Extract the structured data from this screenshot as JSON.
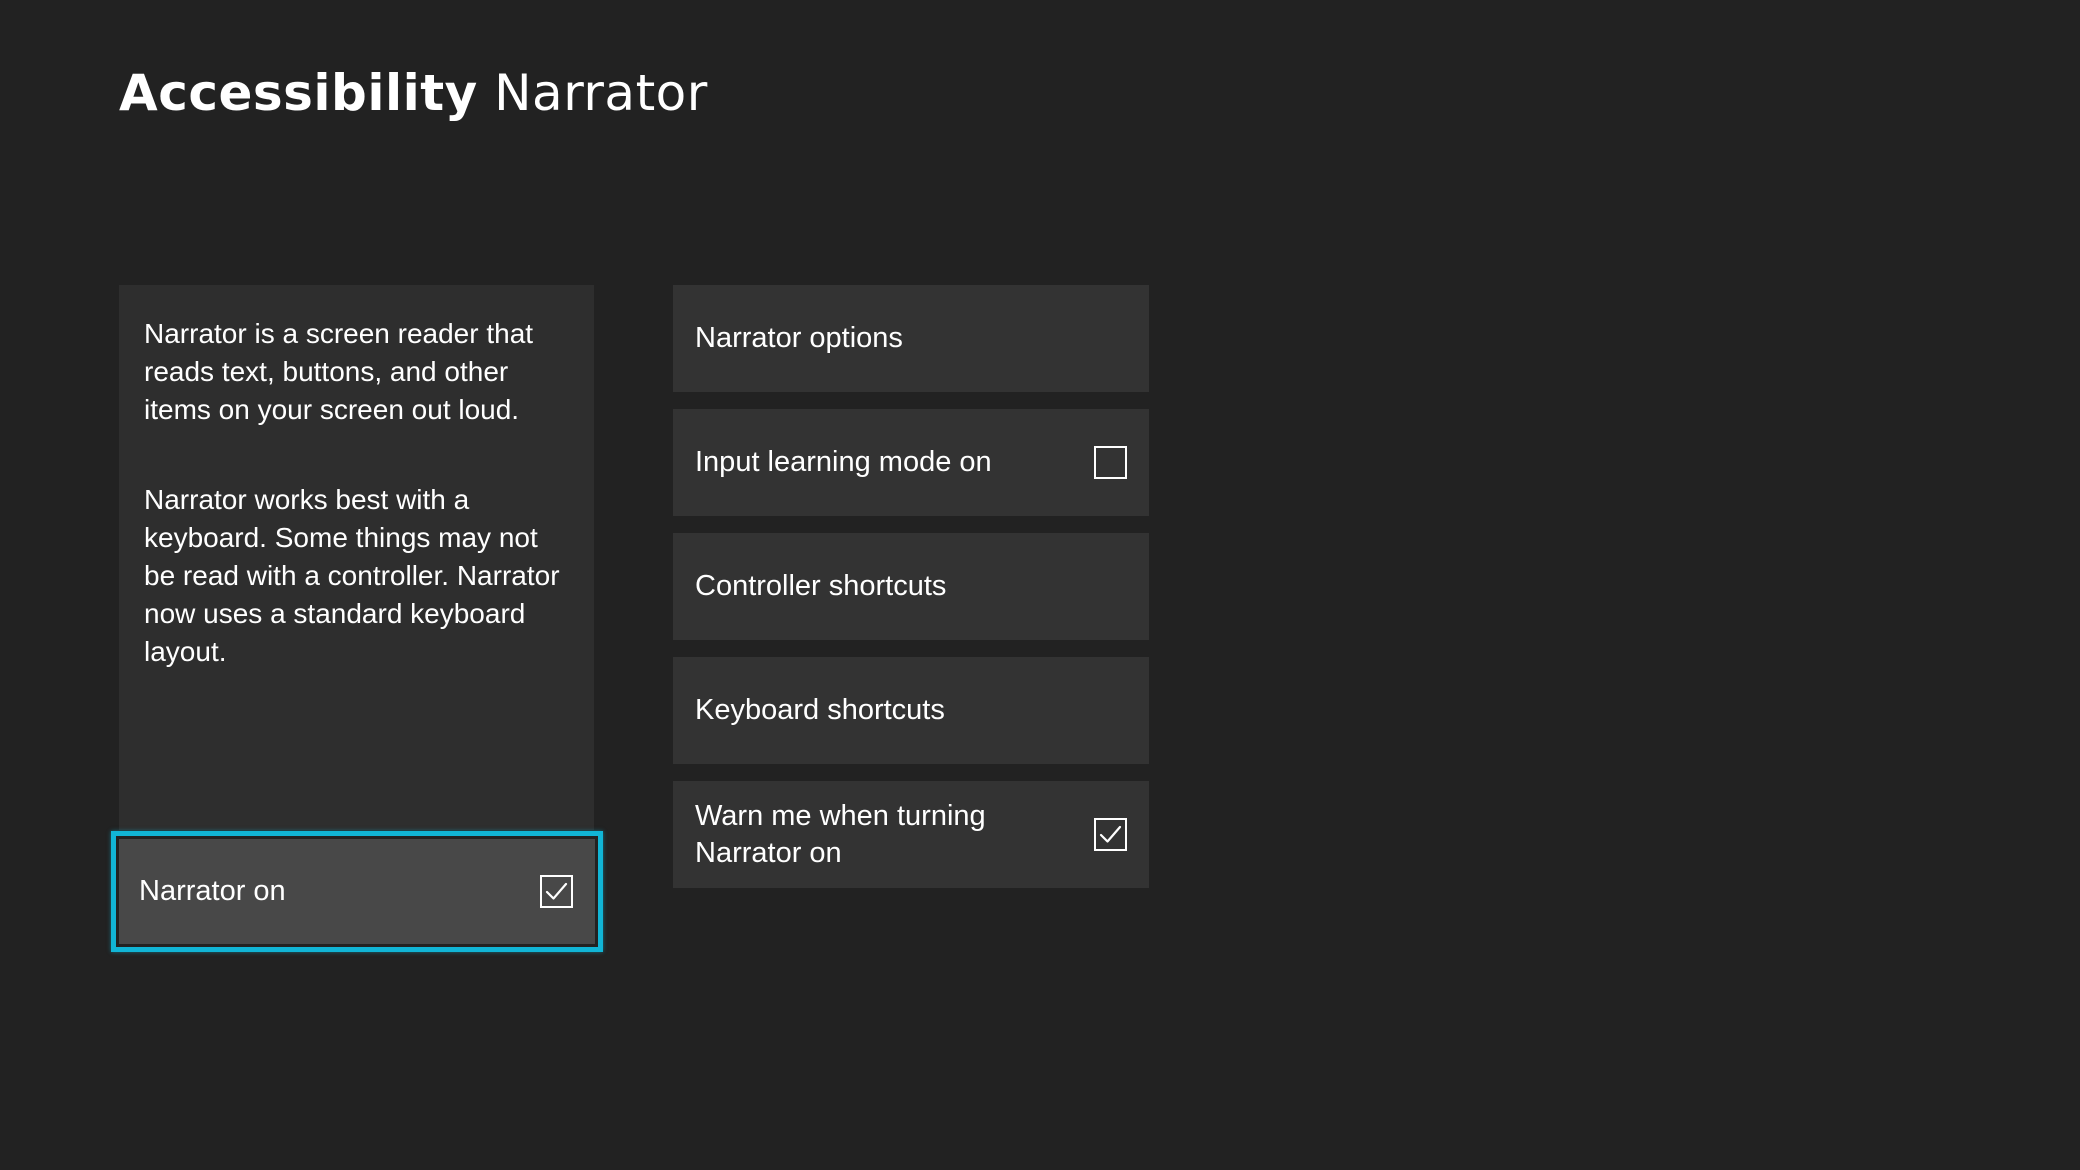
{
  "header": {
    "title_strong": "Accessibility",
    "title_light": "Narrator"
  },
  "description": {
    "paragraphs": [
      "Narrator is a screen reader that reads text, buttons, and other items on your screen out loud.",
      "Narrator works best with a keyboard. Some things may not be read with a controller. Narrator now uses a standard keyboard layout."
    ]
  },
  "narrator_toggle": {
    "label": "Narrator on",
    "checked": true,
    "focused": true,
    "icon": "checkbox-checked-icon"
  },
  "options": [
    {
      "label": "Narrator options"
    },
    {
      "label": "Input learning mode on",
      "checked": false,
      "icon": "checkbox-unchecked-icon"
    },
    {
      "label": "Controller shortcuts"
    },
    {
      "label": "Keyboard shortcuts"
    },
    {
      "label": "Warn me when turning Narrator on",
      "checked": true,
      "icon": "checkbox-checked-icon"
    }
  ],
  "colors": {
    "background": "#222222",
    "panel": "#2e2e2e",
    "option": "#333333",
    "focus_border": "#11b5d6",
    "focused_fill": "#484848",
    "text": "#ffffff"
  }
}
